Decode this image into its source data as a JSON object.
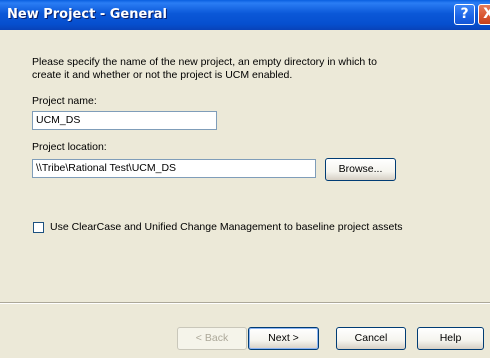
{
  "window": {
    "title": "New Project - General",
    "help_glyph": "?",
    "close_glyph": "X"
  },
  "dialog": {
    "intro": "Please specify the name of the new project, an empty directory in which to create it and whether or not the project is UCM enabled.",
    "project_name": {
      "label": "Project name:",
      "value": "UCM_DS"
    },
    "project_location": {
      "label": "Project location:",
      "value": "\\\\Tribe\\Rational Test\\UCM_DS",
      "browse_label": "Browse..."
    },
    "ucm_checkbox": {
      "label": "Use ClearCase and Unified Change Management to baseline project assets",
      "checked": false
    }
  },
  "buttons": {
    "back": "< Back",
    "next": "Next >",
    "cancel": "Cancel",
    "help": "Help"
  },
  "colors": {
    "titlebar": "#0b58d8",
    "dialog_bg": "#ece9d8",
    "button_border": "#003c74"
  }
}
